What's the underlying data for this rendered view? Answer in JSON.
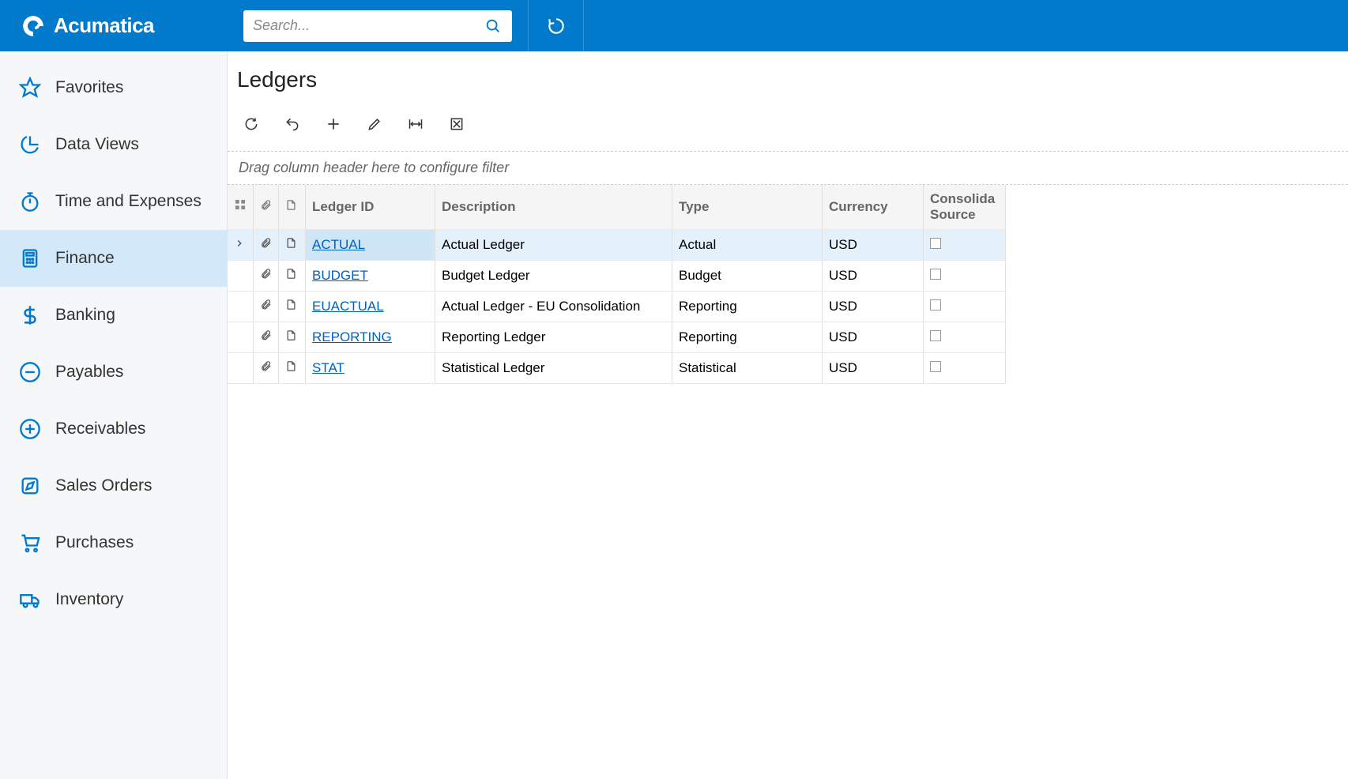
{
  "brand": {
    "name": "Acumatica"
  },
  "search": {
    "placeholder": "Search..."
  },
  "sidebar": {
    "items": [
      {
        "id": "favorites",
        "label": "Favorites",
        "icon": "star"
      },
      {
        "id": "data-views",
        "label": "Data Views",
        "icon": "pie"
      },
      {
        "id": "time-expenses",
        "label": "Time and Expenses",
        "icon": "stopwatch"
      },
      {
        "id": "finance",
        "label": "Finance",
        "icon": "calculator",
        "active": true
      },
      {
        "id": "banking",
        "label": "Banking",
        "icon": "dollar"
      },
      {
        "id": "payables",
        "label": "Payables",
        "icon": "minus-circle"
      },
      {
        "id": "receivables",
        "label": "Receivables",
        "icon": "plus-circle"
      },
      {
        "id": "sales-orders",
        "label": "Sales Orders",
        "icon": "edit-box"
      },
      {
        "id": "purchases",
        "label": "Purchases",
        "icon": "cart"
      },
      {
        "id": "inventory",
        "label": "Inventory",
        "icon": "truck"
      }
    ]
  },
  "page": {
    "title": "Ledgers"
  },
  "toolbar": {
    "refresh": "refresh",
    "undo": "undo",
    "add": "add",
    "edit": "edit",
    "fit": "fit",
    "export": "export"
  },
  "grid": {
    "filter_hint": "Drag column header here to configure filter",
    "columns": {
      "ledger_id": "Ledger ID",
      "description": "Description",
      "type": "Type",
      "currency": "Currency",
      "consolidation_source_l1": "Consolida",
      "consolidation_source_l2": "Source"
    },
    "rows": [
      {
        "ledger_id": "ACTUAL",
        "description": "Actual Ledger",
        "type": "Actual",
        "currency": "USD",
        "consolidation_source": false,
        "selected": true
      },
      {
        "ledger_id": "BUDGET",
        "description": "Budget Ledger",
        "type": "Budget",
        "currency": "USD",
        "consolidation_source": false
      },
      {
        "ledger_id": "EUACTUAL",
        "description": "Actual Ledger - EU Consolidation",
        "type": "Reporting",
        "currency": "USD",
        "consolidation_source": false
      },
      {
        "ledger_id": "REPORTING",
        "description": "Reporting Ledger",
        "type": "Reporting",
        "currency": "USD",
        "consolidation_source": false
      },
      {
        "ledger_id": "STAT",
        "description": "Statistical Ledger",
        "type": "Statistical",
        "currency": "USD",
        "consolidation_source": false
      }
    ]
  }
}
